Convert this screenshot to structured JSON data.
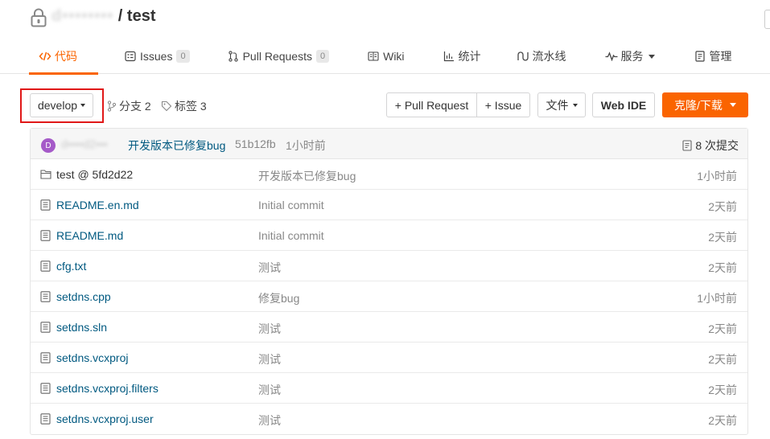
{
  "repo": {
    "owner": "d••••••••",
    "separator": "/",
    "name": "test"
  },
  "tabs": [
    {
      "label": "代码",
      "icon": "code-icon",
      "active": true
    },
    {
      "label": "Issues",
      "icon": "issues-icon",
      "count": "0"
    },
    {
      "label": "Pull Requests",
      "icon": "pull-request-icon",
      "count": "0"
    },
    {
      "label": "Wiki",
      "icon": "wiki-icon"
    },
    {
      "label": "统计",
      "icon": "stats-icon"
    },
    {
      "label": "流水线",
      "icon": "pipeline-icon"
    },
    {
      "label": "服务",
      "icon": "service-icon",
      "dropdown": true
    },
    {
      "label": "管理",
      "icon": "manage-icon"
    }
  ],
  "toolbar": {
    "branch": "develop",
    "branches_label": "分支 2",
    "tags_label": "标签 3",
    "pull_request_button": "+ Pull Request",
    "issue_button": "+ Issue",
    "file_button": "文件",
    "web_ide_button": "Web IDE",
    "clone_button": "克隆/下载"
  },
  "latest_commit": {
    "avatar_letter": "D",
    "author": "d••••d2•••",
    "message": "开发版本已修复bug",
    "hash": "51b12fb",
    "time": "1小时前",
    "count_label": "8 次提交"
  },
  "files": [
    {
      "name": "test @ 5fd2d22",
      "type": "submodule",
      "commit": "开发版本已修复bug",
      "time": "1小时前"
    },
    {
      "name": "README.en.md",
      "type": "file",
      "commit": "Initial commit",
      "time": "2天前"
    },
    {
      "name": "README.md",
      "type": "file",
      "commit": "Initial commit",
      "time": "2天前"
    },
    {
      "name": "cfg.txt",
      "type": "file",
      "commit": "测试",
      "time": "2天前"
    },
    {
      "name": "setdns.cpp",
      "type": "file",
      "commit": "修复bug",
      "time": "1小时前"
    },
    {
      "name": "setdns.sln",
      "type": "file",
      "commit": "测试",
      "time": "2天前"
    },
    {
      "name": "setdns.vcxproj",
      "type": "file",
      "commit": "测试",
      "time": "2天前"
    },
    {
      "name": "setdns.vcxproj.filters",
      "type": "file",
      "commit": "测试",
      "time": "2天前"
    },
    {
      "name": "setdns.vcxproj.user",
      "type": "file",
      "commit": "测试",
      "time": "2天前"
    }
  ],
  "colors": {
    "accent": "#fa6400",
    "link": "#005980",
    "highlight_box": "#e01818"
  }
}
